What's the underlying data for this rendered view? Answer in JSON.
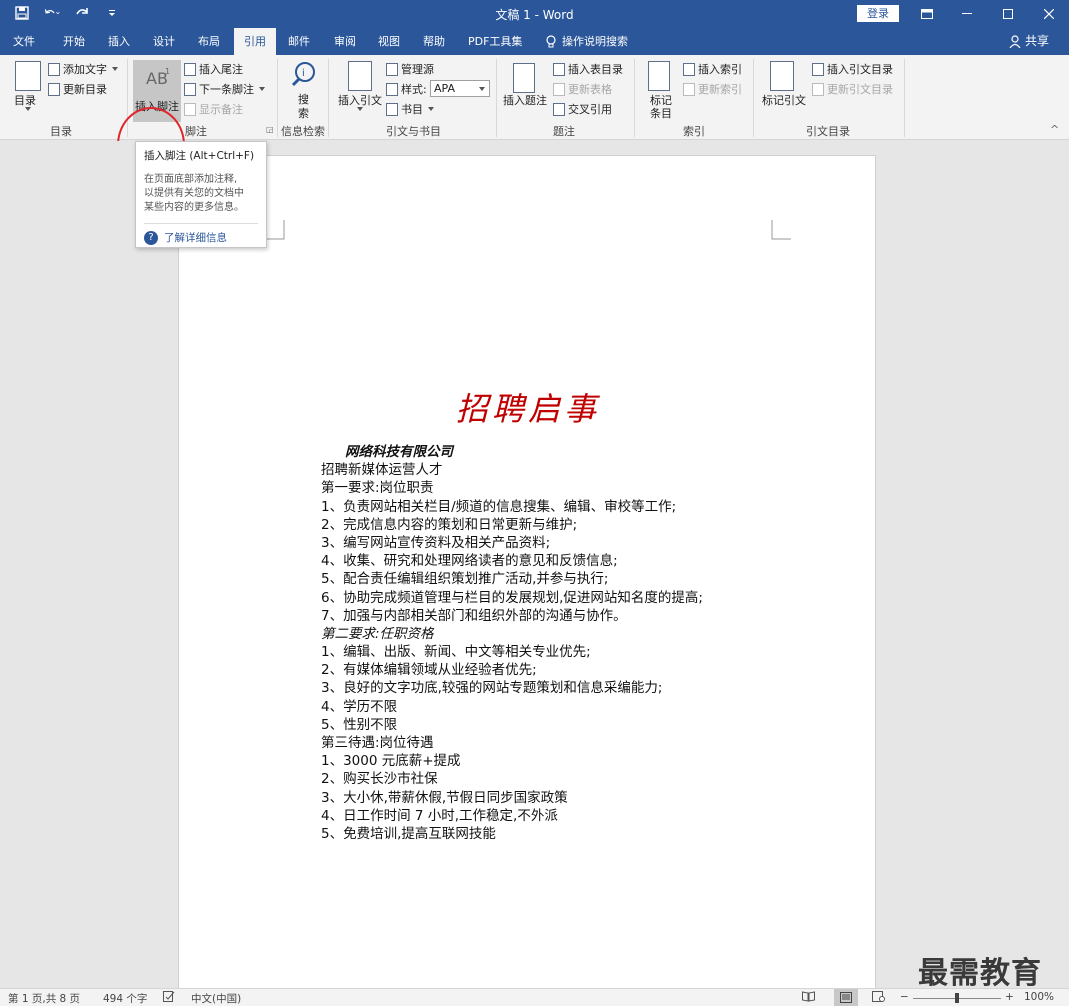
{
  "window": {
    "title": "文稿 1  -  Word",
    "login_label": "登录",
    "ribbon_display_icon": "ribbon-display-icon",
    "minimize_icon": "minimize-icon",
    "maximize_icon": "maximize-icon",
    "close_icon": "close-icon"
  },
  "qat": [
    "save-icon",
    "undo-icon",
    "redo-icon",
    "customize-qat-icon"
  ],
  "tabs": [
    {
      "label": "文件"
    },
    {
      "label": "开始"
    },
    {
      "label": "插入"
    },
    {
      "label": "设计"
    },
    {
      "label": "布局"
    },
    {
      "label": "引用",
      "active": true
    },
    {
      "label": "邮件"
    },
    {
      "label": "审阅"
    },
    {
      "label": "视图"
    },
    {
      "label": "帮助"
    },
    {
      "label": "PDF工具集"
    },
    {
      "label": "操作说明搜索"
    }
  ],
  "share_label": "共享",
  "ribbon": {
    "toc": {
      "big": "目录",
      "add_text": "添加文字",
      "update": "更新目录",
      "group": "目录"
    },
    "footnotes": {
      "insert": "插入脚注",
      "insert_icon_text": "AB",
      "endnote": "插入尾注",
      "next": "下一条脚注",
      "show": "显示备注",
      "group": "脚注"
    },
    "research": {
      "search1": "搜",
      "search2": "索",
      "group": "信息检索"
    },
    "citations": {
      "insert": "插入引文",
      "manage": "管理源",
      "style_label": "样式:",
      "style_value": "APA",
      "biblio": "书目",
      "group": "引文与书目"
    },
    "captions": {
      "insert": "插入题注",
      "table_of_figures": "插入表目录",
      "update_table": "更新表格",
      "cross_ref": "交叉引用",
      "group": "题注"
    },
    "index": {
      "mark1": "标记",
      "mark2": "条目",
      "insert": "插入索引",
      "update": "更新索引",
      "group": "索引"
    },
    "toa": {
      "mark": "标记引文",
      "insert": "插入引文目录",
      "update": "更新引文目录",
      "group": "引文目录"
    }
  },
  "tooltip": {
    "title": "插入脚注 (Alt+Ctrl+F)",
    "desc1": "在页面底部添加注释,",
    "desc2": "以提供有关您的文档中",
    "desc3": "某些内容的更多信息。",
    "help": "了解详细信息"
  },
  "document": {
    "heading": "招聘启事",
    "lines": [
      {
        "text": "网络科技有限公司",
        "style": "company"
      },
      {
        "text": "招聘新媒体运营人才"
      },
      {
        "text": "第一要求:岗位职责"
      },
      {
        "text": "1、负责网站相关栏目/频道的信息搜集、编辑、审校等工作;"
      },
      {
        "text": "2、完成信息内容的策划和日常更新与维护;"
      },
      {
        "text": "3、编写网站宣传资料及相关产品资料;"
      },
      {
        "text": "4、收集、研究和处理网络读者的意见和反馈信息;"
      },
      {
        "text": "5、配合责任编辑组织策划推广活动,并参与执行;"
      },
      {
        "text": "6、协助完成频道管理与栏目的发展规划,促进网站知名度的提高;"
      },
      {
        "text": "7、加强与内部相关部门和组织外部的沟通与协作。"
      },
      {
        "text": "第二要求:任职资格",
        "style": "it"
      },
      {
        "text": "1、编辑、出版、新闻、中文等相关专业优先;"
      },
      {
        "text": "2、有媒体编辑领域从业经验者优先;"
      },
      {
        "text": "3、良好的文字功底,较强的网站专题策划和信息采编能力;"
      },
      {
        "text": "4、学历不限"
      },
      {
        "text": "5、性别不限"
      },
      {
        "text": "第三待遇:岗位待遇"
      },
      {
        "text": "1、3000 元底薪+提成"
      },
      {
        "text": "2、购买长沙市社保"
      },
      {
        "text": "3、大小休,带薪休假,节假日同步国家政策"
      },
      {
        "text": "4、日工作时间 7 小时,工作稳定,不外派"
      },
      {
        "text": "5、免费培训,提高互联网技能"
      }
    ]
  },
  "watermark": "最需教育",
  "status": {
    "page": "第 1 页,共 8 页",
    "words": "494 个字",
    "lang": "中文(中国)",
    "zoom_minus": "−",
    "zoom_plus": "+",
    "zoom": "100%",
    "zoom_level": 100
  },
  "colors": {
    "brand": "#2b579a",
    "heading": "#c00000",
    "highlight_circle": "#e0262b"
  }
}
